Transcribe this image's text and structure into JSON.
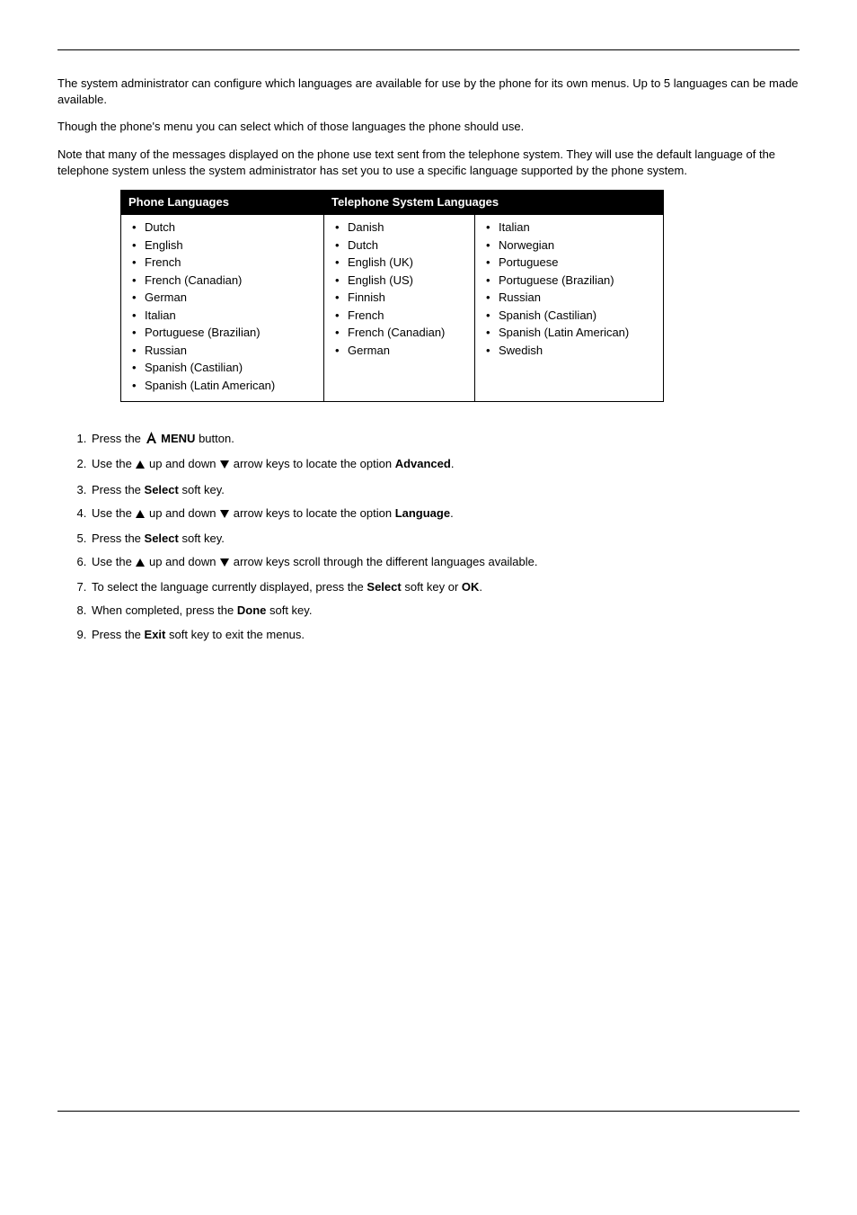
{
  "paragraph1": "The system administrator can configure which languages are available for use by the phone for its own menus. Up to 5 languages can be made available.",
  "paragraph2": "Though the phone's menu you can select which of those languages the phone should use.",
  "paragraph3": "Note that many of the messages displayed on the phone use text sent from the telephone system. They will use the default language of the telephone system unless the system administrator has set you to use a specific language supported by the phone system.",
  "table": {
    "headers": {
      "phone": "Phone Languages",
      "system": "Telephone System Languages"
    },
    "phone_languages": [
      "Dutch",
      "English",
      "French",
      "French (Canadian)",
      "German",
      "Italian",
      "Portuguese (Brazilian)",
      "Russian",
      "Spanish (Castilian)",
      "Spanish (Latin American)"
    ],
    "system_languages_col1": [
      "Danish",
      "Dutch",
      "English (UK)",
      "English (US)",
      "Finnish",
      "French",
      "French (Canadian)",
      "German"
    ],
    "system_languages_col2": [
      "Italian",
      "Norwegian",
      "Portuguese",
      "Portuguese (Brazilian)",
      "Russian",
      "Spanish (Castilian)",
      "Spanish (Latin American)",
      "Swedish"
    ]
  },
  "steps": {
    "s1_pre": "Press the ",
    "s1_menu": "MENU",
    "s1_post": " button.",
    "s2_pre": "Use the ",
    "s2_mid1": " up and down ",
    "s2_mid2": " arrow keys to locate the option ",
    "s2_adv": "Advanced",
    "s2_post": ".",
    "s3_pre": "Press the ",
    "s3_select": "Select",
    "s3_post": " soft key.",
    "s4_pre": "Use the ",
    "s4_mid1": " up and down ",
    "s4_mid2": " arrow keys to locate the option ",
    "s4_lang": "Language",
    "s4_post": ".",
    "s5_pre": "Press the ",
    "s5_select": "Select",
    "s5_post": " soft key.",
    "s6_pre": "Use the ",
    "s6_mid1": " up and down ",
    "s6_post": " arrow keys scroll through the different languages available.",
    "s7_pre": "To select the language currently displayed, press the ",
    "s7_select": "Select",
    "s7_mid": " soft key or ",
    "s7_ok": "OK",
    "s7_post": ".",
    "s8_pre": "When completed, press the ",
    "s8_done": "Done",
    "s8_post": " soft key.",
    "s9_pre": "Press the ",
    "s9_exit": "Exit",
    "s9_post": " soft key to exit the menus."
  }
}
